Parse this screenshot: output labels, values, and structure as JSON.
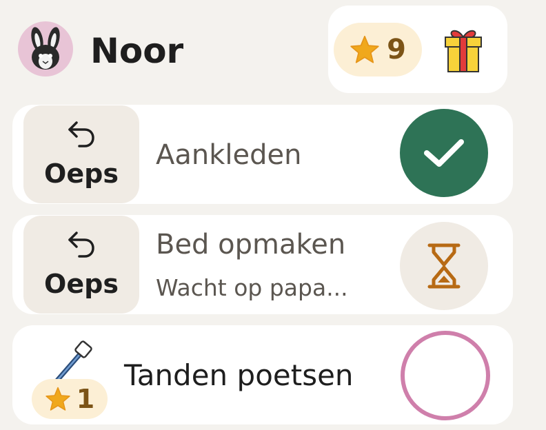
{
  "profile": {
    "name": "Noor",
    "avatar_icon": "rabbit-icon",
    "avatar_bg": "#e8c4d6"
  },
  "rewards": {
    "stars": "9",
    "star_icon": "star-icon",
    "gift_icon": "gift-icon"
  },
  "tasks": [
    {
      "title": "Aankleden",
      "undo_label": "Oeps",
      "status": "done",
      "status_color": "#2e7356"
    },
    {
      "title": "Bed opmaken",
      "subtitle": "Wacht op papa...",
      "undo_label": "Oeps",
      "status": "waiting",
      "status_icon": "hourglass-icon"
    },
    {
      "title": "Tanden poetsen",
      "stars": "1",
      "icon": "toothbrush-icon",
      "status": "todo",
      "status_color": "#cf7fab"
    }
  ]
}
